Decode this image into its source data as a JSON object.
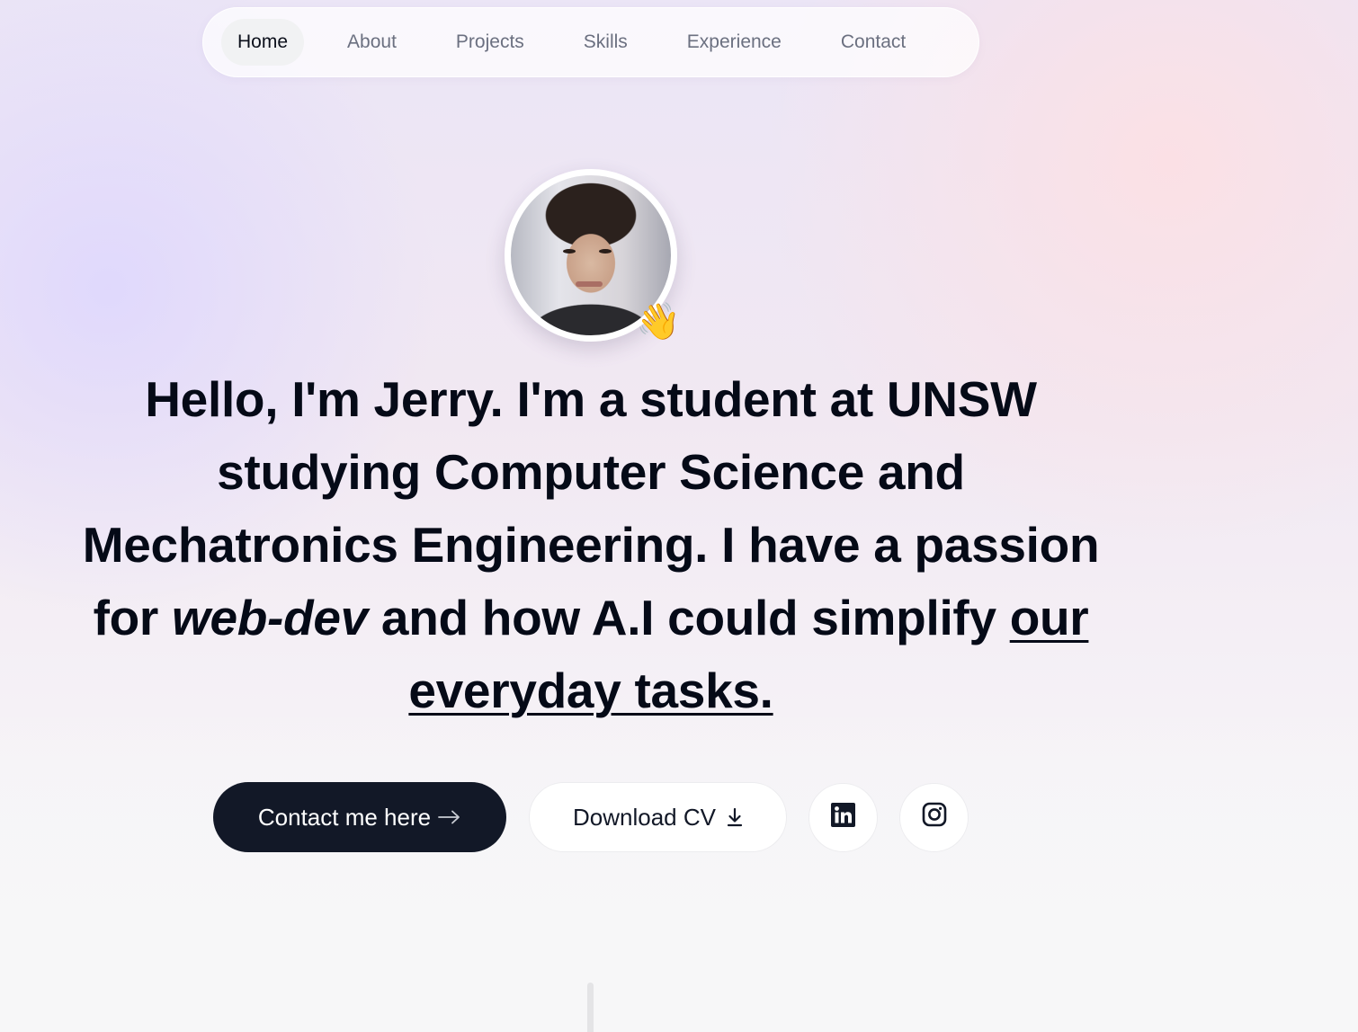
{
  "nav": {
    "items": [
      {
        "label": "Home",
        "active": true
      },
      {
        "label": "About",
        "active": false
      },
      {
        "label": "Projects",
        "active": false
      },
      {
        "label": "Skills",
        "active": false
      },
      {
        "label": "Experience",
        "active": false
      },
      {
        "label": "Contact",
        "active": false
      }
    ]
  },
  "hero": {
    "avatar_alt": "Profile photo of Jerry",
    "wave_emoji": "👋",
    "headline": {
      "greeting": "Hello, I'm Jerry.",
      "part1": " I'm a ",
      "role": "student at UNSW",
      "part2": " studying Computer Science and Mechatronics Engineering. I have a passion for ",
      "emphasis": "web-dev",
      "part3": " and how A.I could simplify ",
      "underlined": "our everyday tasks."
    },
    "buttons": {
      "contact_label": "Contact me here",
      "contact_icon": "→",
      "cv_label": "Download CV",
      "linkedin_label": "LinkedIn",
      "instagram_label": "Instagram"
    }
  },
  "colors": {
    "primary_dark": "#121827",
    "nav_active_bg": "#f1f2f3",
    "nav_inactive_text": "#6b7080",
    "text": "#050a17"
  }
}
